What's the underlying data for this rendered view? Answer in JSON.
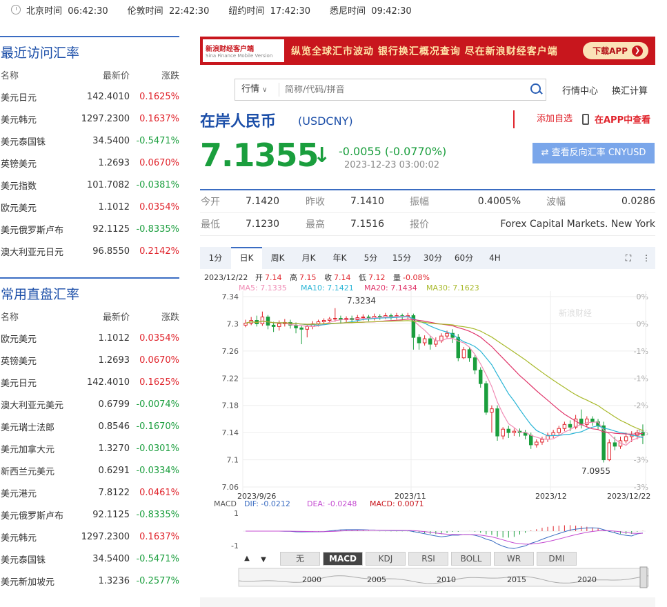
{
  "topbar": {
    "zones": [
      {
        "city": "北京时间",
        "time": "06:42:30"
      },
      {
        "city": "伦敦时间",
        "time": "22:42:30"
      },
      {
        "city": "纽约时间",
        "time": "17:42:30"
      },
      {
        "city": "悉尼时间",
        "time": "09:42:30"
      }
    ]
  },
  "recent": {
    "title": "最近访问汇率",
    "headers": [
      "名称",
      "最新价",
      "涨跌"
    ],
    "rows": [
      [
        "美元日元",
        "142.4010",
        "0.1625%"
      ],
      [
        "美元韩元",
        "1297.2300",
        "0.1637%"
      ],
      [
        "美元泰国铢",
        "34.5400",
        "-0.5471%"
      ],
      [
        "英镑美元",
        "1.2693",
        "0.0670%"
      ],
      [
        "美元指数",
        "101.7082",
        "-0.0381%"
      ],
      [
        "欧元美元",
        "1.1012",
        "0.0354%"
      ],
      [
        "美元俄罗斯卢布",
        "92.1125",
        "-0.8335%"
      ],
      [
        "澳大利亚元日元",
        "96.8550",
        "0.2142%"
      ]
    ]
  },
  "direct": {
    "title": "常用直盘汇率",
    "headers": [
      "名称",
      "最新价",
      "涨跌"
    ],
    "rows": [
      [
        "欧元美元",
        "1.1012",
        "0.0354%"
      ],
      [
        "英镑美元",
        "1.2693",
        "0.0670%"
      ],
      [
        "美元日元",
        "142.4010",
        "0.1625%"
      ],
      [
        "澳大利亚元美元",
        "0.6799",
        "-0.0074%"
      ],
      [
        "美元瑞士法郎",
        "0.8546",
        "-0.1670%"
      ],
      [
        "美元加拿大元",
        "1.3270",
        "-0.0301%"
      ],
      [
        "新西兰元美元",
        "0.6291",
        "-0.0334%"
      ],
      [
        "美元港元",
        "7.8122",
        "0.0461%"
      ],
      [
        "美元俄罗斯卢布",
        "92.1125",
        "-0.8335%"
      ],
      [
        "美元韩元",
        "1297.2300",
        "0.1637%"
      ],
      [
        "美元泰国铢",
        "34.5400",
        "-0.5471%"
      ],
      [
        "美元新加坡元",
        "1.3236",
        "-0.2577%"
      ]
    ]
  },
  "banner": {
    "brand": "新浪财经客户端",
    "brand_sub": "Sina Finance Mobile Version",
    "slogan": "纵览全球汇市波动 银行换汇概况查询 尽在新浪财经客户端",
    "download": "下载APP"
  },
  "search": {
    "select": "行情",
    "placeholder": "简称/代码/拼音"
  },
  "links": {
    "center": "行情中心",
    "calc": "换汇计算"
  },
  "header": {
    "title": "在岸人民币",
    "code": "(USDCNY)",
    "add_fav": "添加自选",
    "app_view": "在APP中查看"
  },
  "quote": {
    "price": "7.1355",
    "arrow": "↓",
    "change": "-0.0055 (-0.0770%)",
    "time": "2023-12-23 03:00:02",
    "reverse": "⇄ 查看反向汇率 CNYUSD",
    "open_label": "今开",
    "open": "7.1420",
    "prev_label": "昨收",
    "prev": "7.1410",
    "amp_label": "振幅",
    "amp": "0.4005%",
    "wave_label": "波幅",
    "wave": "0.0286",
    "low_label": "最低",
    "low": "7.1230",
    "high_label": "最高",
    "high": "7.1516",
    "src_label": "报价",
    "src": "Forex Capital Markets. New York"
  },
  "chart_tabs": [
    "1分",
    "日K",
    "周K",
    "月K",
    "年K",
    "5分",
    "15分",
    "30分",
    "60分",
    "4H"
  ],
  "ohlc_line": {
    "date": "2023/12/22",
    "o_label": "开",
    "o": "7.14",
    "h_label": "高",
    "h": "7.15",
    "c_label": "收",
    "c": "7.14",
    "l_label": "低",
    "l": "7.12",
    "v_label": "量",
    "v": "-0.08%"
  },
  "ma_line": {
    "ma5": "MA5: 7.1335",
    "ma10": "MA10: 7.1421",
    "ma20": "MA20: 7.1434",
    "ma30": "MA30: 7.1623"
  },
  "macd_line": {
    "label": "MACD",
    "dif": "DIF: -0.0212",
    "dea": "DEA: -0.0248",
    "macd": "MACD: 0.0071"
  },
  "indicator_tabs": [
    "无",
    "MACD",
    "KDJ",
    "RSI",
    "BOLL",
    "WR",
    "DMI"
  ],
  "colors": {
    "up": "#e0232b",
    "down": "#1a9e3d",
    "accent": "#1b4ea8",
    "ma5": "#f08cb5",
    "ma10": "#2ab5d6",
    "ma20": "#e0356a",
    "ma30": "#a8b92a"
  },
  "chart_data": {
    "type": "candlestick",
    "y_ticks": [
      "7.34",
      "7.3",
      "7.26",
      "7.22",
      "7.18",
      "7.14",
      "7.1",
      "7.06"
    ],
    "y_pct_ticks": [
      "0%",
      "0%",
      "-1%",
      "-1%",
      "-2%",
      "-2%",
      "-3%",
      "-3%"
    ],
    "ylim": [
      7.06,
      7.34
    ],
    "x_labels": [
      "2023/9/26",
      "2023/11",
      "2023/12",
      "2023/12/22"
    ],
    "annotations": {
      "max": "7.3234",
      "min": "7.0955"
    },
    "watermark": "新浪财经",
    "macd_ticks": [
      "1",
      "-1"
    ],
    "overview_years": [
      "2000",
      "2005",
      "2010",
      "2015",
      "2020"
    ],
    "candles": [
      [
        7.298,
        7.301,
        7.295,
        7.306
      ],
      [
        7.301,
        7.305,
        7.298,
        7.31
      ],
      [
        7.305,
        7.3,
        7.296,
        7.312
      ],
      [
        7.3,
        7.31,
        7.297,
        7.318
      ],
      [
        7.31,
        7.298,
        7.292,
        7.313
      ],
      [
        7.298,
        7.296,
        7.288,
        7.303
      ],
      [
        7.296,
        7.3,
        7.29,
        7.305
      ],
      [
        7.3,
        7.302,
        7.296,
        7.307
      ],
      [
        7.302,
        7.298,
        7.293,
        7.306
      ],
      [
        7.298,
        7.294,
        7.286,
        7.302
      ],
      [
        7.294,
        7.292,
        7.27,
        7.298
      ],
      [
        7.292,
        7.296,
        7.28,
        7.3
      ],
      [
        7.296,
        7.3,
        7.292,
        7.304
      ],
      [
        7.3,
        7.303,
        7.296,
        7.306
      ],
      [
        7.303,
        7.305,
        7.3,
        7.308
      ],
      [
        7.305,
        7.307,
        7.302,
        7.31
      ],
      [
        7.307,
        7.308,
        7.303,
        7.323
      ],
      [
        7.308,
        7.306,
        7.3,
        7.312
      ],
      [
        7.306,
        7.308,
        7.302,
        7.311
      ],
      [
        7.308,
        7.306,
        7.301,
        7.312
      ],
      [
        7.306,
        7.309,
        7.303,
        7.313
      ],
      [
        7.309,
        7.31,
        7.305,
        7.314
      ],
      [
        7.31,
        7.308,
        7.304,
        7.313
      ],
      [
        7.308,
        7.311,
        7.305,
        7.315
      ],
      [
        7.311,
        7.31,
        7.306,
        7.314
      ],
      [
        7.31,
        7.312,
        7.307,
        7.316
      ],
      [
        7.312,
        7.31,
        7.306,
        7.315
      ],
      [
        7.31,
        7.312,
        7.306,
        7.316
      ],
      [
        7.312,
        7.311,
        7.306,
        7.315
      ],
      [
        7.311,
        7.312,
        7.307,
        7.316
      ],
      [
        7.312,
        7.28,
        7.262,
        7.315
      ],
      [
        7.28,
        7.272,
        7.262,
        7.285
      ],
      [
        7.272,
        7.278,
        7.268,
        7.283
      ],
      [
        7.278,
        7.27,
        7.262,
        7.282
      ],
      [
        7.27,
        7.275,
        7.266,
        7.28
      ],
      [
        7.275,
        7.282,
        7.272,
        7.286
      ],
      [
        7.282,
        7.286,
        7.278,
        7.29
      ],
      [
        7.286,
        7.28,
        7.272,
        7.292
      ],
      [
        7.28,
        7.25,
        7.245,
        7.285
      ],
      [
        7.25,
        7.262,
        7.248,
        7.266
      ],
      [
        7.262,
        7.25,
        7.244,
        7.266
      ],
      [
        7.25,
        7.232,
        7.226,
        7.254
      ],
      [
        7.232,
        7.212,
        7.206,
        7.236
      ],
      [
        7.212,
        7.17,
        7.166,
        7.216
      ],
      [
        7.17,
        7.175,
        7.14,
        7.18
      ],
      [
        7.175,
        7.135,
        7.128,
        7.18
      ],
      [
        7.135,
        7.145,
        7.13,
        7.148
      ],
      [
        7.145,
        7.14,
        7.132,
        7.15
      ],
      [
        7.14,
        7.142,
        7.135,
        7.146
      ],
      [
        7.142,
        7.14,
        7.134,
        7.146
      ],
      [
        7.14,
        7.136,
        7.13,
        7.144
      ],
      [
        7.136,
        7.122,
        7.116,
        7.14
      ],
      [
        7.122,
        7.126,
        7.118,
        7.13
      ],
      [
        7.126,
        7.13,
        7.122,
        7.134
      ],
      [
        7.13,
        7.136,
        7.126,
        7.14
      ],
      [
        7.136,
        7.14,
        7.132,
        7.144
      ],
      [
        7.14,
        7.146,
        7.136,
        7.15
      ],
      [
        7.146,
        7.152,
        7.142,
        7.156
      ],
      [
        7.152,
        7.148,
        7.142,
        7.158
      ],
      [
        7.148,
        7.16,
        7.145,
        7.166
      ],
      [
        7.16,
        7.152,
        7.146,
        7.174
      ],
      [
        7.152,
        7.16,
        7.148,
        7.164
      ],
      [
        7.16,
        7.156,
        7.15,
        7.164
      ],
      [
        7.156,
        7.15,
        7.144,
        7.16
      ],
      [
        7.15,
        7.1,
        7.096,
        7.156
      ],
      [
        7.1,
        7.125,
        7.098,
        7.13
      ],
      [
        7.125,
        7.12,
        7.114,
        7.134
      ],
      [
        7.12,
        7.128,
        7.116,
        7.134
      ],
      [
        7.128,
        7.134,
        7.124,
        7.14
      ],
      [
        7.134,
        7.136,
        7.126,
        7.142
      ],
      [
        7.136,
        7.14,
        7.13,
        7.144
      ],
      [
        7.14,
        7.136,
        7.123,
        7.152
      ]
    ]
  }
}
